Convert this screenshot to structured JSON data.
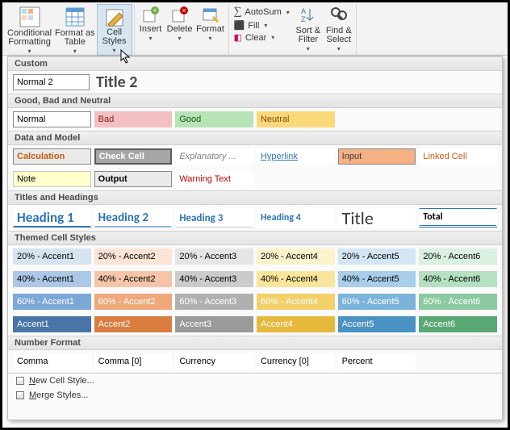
{
  "ribbon": {
    "cond_fmt": "Conditional\nFormatting",
    "fmt_table": "Format as\nTable",
    "cell_styles": "Cell\nStyles",
    "insert": "Insert",
    "delete": "Delete",
    "format": "Format",
    "autosum": "AutoSum",
    "fill": "Fill",
    "clear": "Clear",
    "sort": "Sort &\nFilter",
    "find": "Find &\nSelect"
  },
  "sections": {
    "custom": "Custom",
    "gbn": "Good, Bad and Neutral",
    "dm": "Data and Model",
    "th": "Titles and Headings",
    "tcs": "Themed Cell Styles",
    "nf": "Number Format"
  },
  "custom": {
    "normal2": "Normal 2",
    "title2": "Title 2"
  },
  "gbn": {
    "normal": "Normal",
    "bad": "Bad",
    "good": "Good",
    "neutral": "Neutral"
  },
  "dm": {
    "calc": "Calculation",
    "check": "Check Cell",
    "expl": "Explanatory ...",
    "hyper": "Hyperlink",
    "input": "Input",
    "linked": "Linked Cell",
    "note": "Note",
    "output": "Output",
    "warn": "Warning Text"
  },
  "th": {
    "h1": "Heading 1",
    "h2": "Heading 2",
    "h3": "Heading 3",
    "h4": "Heading 4",
    "title": "Title",
    "total": "Total"
  },
  "themed": {
    "r20": [
      "20% - Accent1",
      "20% - Accent2",
      "20% - Accent3",
      "20% - Accent4",
      "20% - Accent5",
      "20% - Accent6"
    ],
    "r40": [
      "40% - Accent1",
      "40% - Accent2",
      "40% - Accent3",
      "40% - Accent4",
      "40% - Accent5",
      "40% - Accent6"
    ],
    "r60": [
      "60% - Accent1",
      "60% - Accent2",
      "60% - Accent3",
      "60% - Accent4",
      "60% - Accent5",
      "60% - Accent6"
    ],
    "acc": [
      "Accent1",
      "Accent2",
      "Accent3",
      "Accent4",
      "Accent5",
      "Accent6"
    ]
  },
  "nf": {
    "comma": "Comma",
    "comma0": "Comma [0]",
    "currency": "Currency",
    "currency0": "Currency [0]",
    "percent": "Percent"
  },
  "footer": {
    "newstyle_u": "N",
    "newstyle": "ew Cell Style...",
    "merge_u": "M",
    "merge": "erge Styles..."
  }
}
